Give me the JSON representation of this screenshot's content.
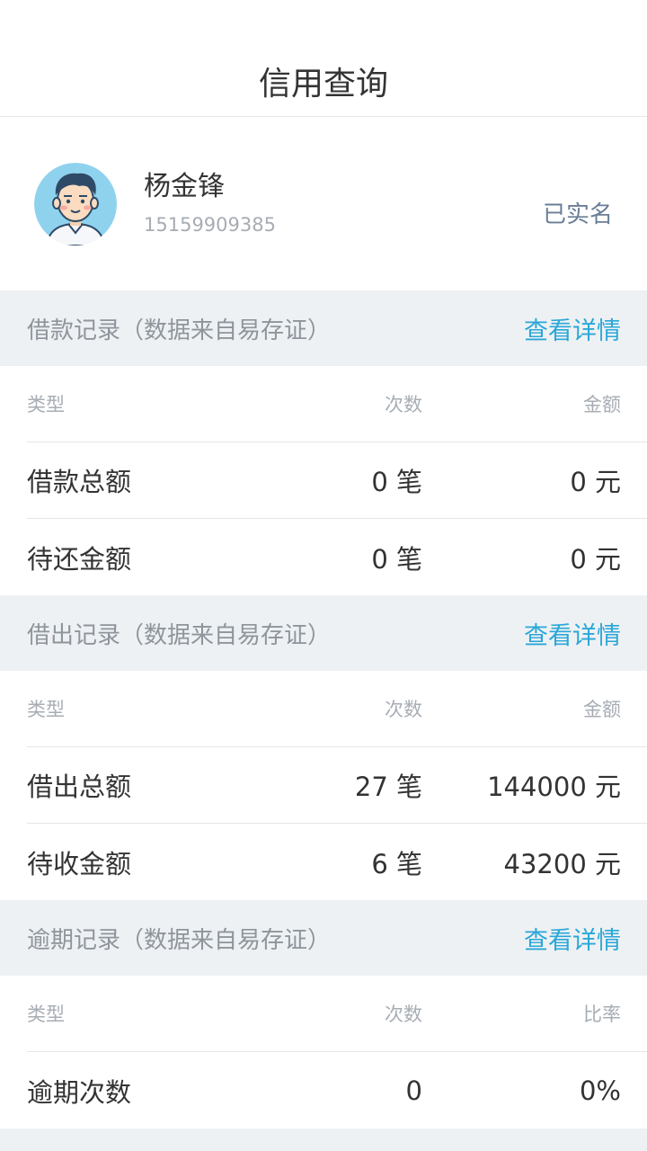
{
  "header": {
    "title": "信用查询"
  },
  "profile": {
    "name": "杨金锋",
    "phone": "15159909385",
    "status": "已实名"
  },
  "sections": [
    {
      "title": "借款记录（数据来自易存证）",
      "link": "查看详情",
      "columns": [
        "类型",
        "次数",
        "金额"
      ],
      "rows": [
        [
          "借款总额",
          "0 笔",
          "0 元"
        ],
        [
          "待还金额",
          "0 笔",
          "0 元"
        ]
      ]
    },
    {
      "title": "借出记录（数据来自易存证）",
      "link": "查看详情",
      "columns": [
        "类型",
        "次数",
        "金额"
      ],
      "rows": [
        [
          "借出总额",
          "27 笔",
          "144000 元"
        ],
        [
          "待收金额",
          "6 笔",
          "43200 元"
        ]
      ]
    },
    {
      "title": "逾期记录（数据来自易存证）",
      "link": "查看详情",
      "columns": [
        "类型",
        "次数",
        "比率"
      ],
      "rows": [
        [
          "逾期次数",
          "0",
          "0%"
        ]
      ]
    }
  ],
  "colors": {
    "link": "#2aa7d8",
    "section_bg": "#eef1f3",
    "verified": "#6a7e96",
    "avatar_bg": "#8fd2ee"
  }
}
